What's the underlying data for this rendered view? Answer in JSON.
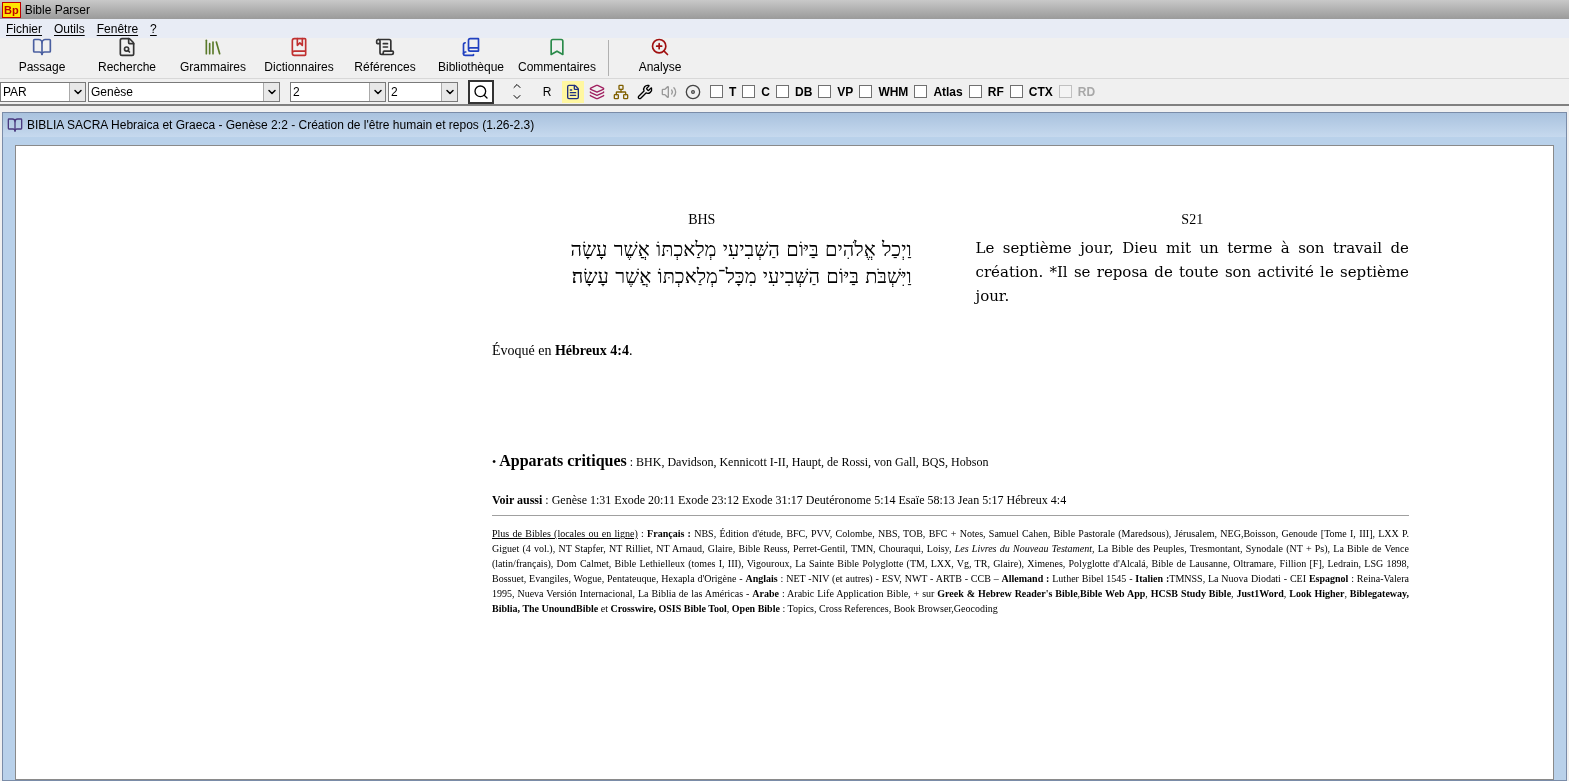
{
  "app": {
    "logo": "Bp",
    "title": "Bible Parser"
  },
  "menu": [
    {
      "label": "Fichier"
    },
    {
      "label": "Outils"
    },
    {
      "label": "Fenêtre"
    },
    {
      "label": "?"
    }
  ],
  "toolbar": [
    {
      "label": "Passage",
      "kind": "book"
    },
    {
      "label": "Recherche",
      "kind": "search"
    },
    {
      "label": "Grammaires",
      "kind": "books"
    },
    {
      "label": "Dictionnaires",
      "kind": "dict"
    },
    {
      "label": "Références",
      "kind": "scroll"
    },
    {
      "label": "Bibliothèque",
      "kind": "library"
    },
    {
      "label": "Commentaires",
      "kind": "comment"
    },
    {
      "label": "Analyse",
      "kind": "analyse"
    }
  ],
  "selectors": [
    {
      "value": "PAR"
    },
    {
      "value": "Genèse"
    },
    {
      "value": "2"
    },
    {
      "value": "2"
    }
  ],
  "r_button": "R",
  "options": [
    {
      "label": "T",
      "checked": false,
      "disabled": false
    },
    {
      "label": "C",
      "checked": false,
      "disabled": false
    },
    {
      "label": "DB",
      "checked": false,
      "disabled": false
    },
    {
      "label": "VP",
      "checked": false,
      "disabled": false
    },
    {
      "label": "WHM",
      "checked": false,
      "disabled": false
    },
    {
      "label": "Atlas",
      "checked": false,
      "disabled": false
    },
    {
      "label": "RF",
      "checked": false,
      "disabled": false
    },
    {
      "label": "CTX",
      "checked": false,
      "disabled": false
    },
    {
      "label": "RD",
      "checked": false,
      "disabled": true
    }
  ],
  "document_window": {
    "title": "BIBLIA SACRA Hebraica et Graeca - Genèse 2:2 - Création de l'être humain et repos (1.26-2.3)"
  },
  "columns": [
    {
      "heading": "BHS",
      "kind": "hebrew",
      "lines": [
        "וַיְכַל אֱלֹהִים בַּיּוֹם הַשְּׁבִיעִי מְלַאכְתּוֹ אֲשֶׁר עָשָׂה",
        "וַיִּשְׁבֹּת בַּיּוֹם הַשְּׁבִיעִי מִכָּל־מְלַאכְתּוֹ אֲשֶׁר עָשָׂה׃"
      ]
    },
    {
      "heading": "S21",
      "kind": "french",
      "lines": [
        "Le septième jour, Dieu mit un terme à son travail de création. *Il se reposa de toute son activité le septième jour."
      ]
    }
  ],
  "evoked": "Évoqué en **Hébreux 4:4**.",
  "apparatus": "• **Apparats critiques** : BHK, Davidson, Kennicott I-II, Haupt, de Rossi, von Gall, BQS, Hobson",
  "see_also": "**Voir aussi** : Genèse 1:31 Exode 20:11 Exode 23:12 Exode 31:17 Deutéronome 5:14 Esaïe 58:13 Jean 5:17 Hébreux 4:4",
  "more_bibles": {
    "link": "Plus de Bibles (locales ou en ligne)",
    "text": " : **Français :** NBS, Édition d'étude, BFC, PVV, Colombe, NBS, TOB, BFC + Notes, Samuel Cahen, Bible Pastorale (Maredsous), Jérusalem, NEG,Boisson, Genoude [Tome I, III], LXX P. Giguet (4 vol.), NT Stapfer, NT Rilliet, NT Arnaud, Glaire, Bible Reuss, Perret-Gentil, TMN, Chouraqui, Loisy, *Les Livres du Nouveau Testament*, La Bible des Peuples, Tresmontant, Synodale (NT + Ps), La Bible de Vence (latin/français), Dom Calmet, Bible Lethielleux (tomes I, III), Vigouroux, La Sainte Bible Polyglotte (TM, LXX, Vg, TR, Glaire), Ximenes, Polyglotte d'Alcalá, Bible de Lausanne, Oltramare, Fillion [F], Ledrain, LSG 1898, Bossuet, Evangiles, Wogue, Pentateuque, Hexapla d'Origène - **Anglais** : NET -NIV (et autres) - ESV, NWT - ARTB - CCB – **Allemand :** Luther Bibel 1545 - **Italien :**TMNSS, La Nuova Diodati - CEI **Espagnol** : Reina-Valera 1995, Nueva Versión Internacional, La Biblia de las Américas - **Arabe** : Arabic Life Application Bible, + sur **Greek & Hebrew Reader's Bible**,**Bible Web App**, **HCSB Study Bible**, **Just1Word**, **Look Higher**, **Biblegateway, Biblia, The UnoundBible** et **Crosswire, OSIS Bible Tool**, **Open Bible** : Topics, Cross References, Book Browser,Geocoding"
  }
}
